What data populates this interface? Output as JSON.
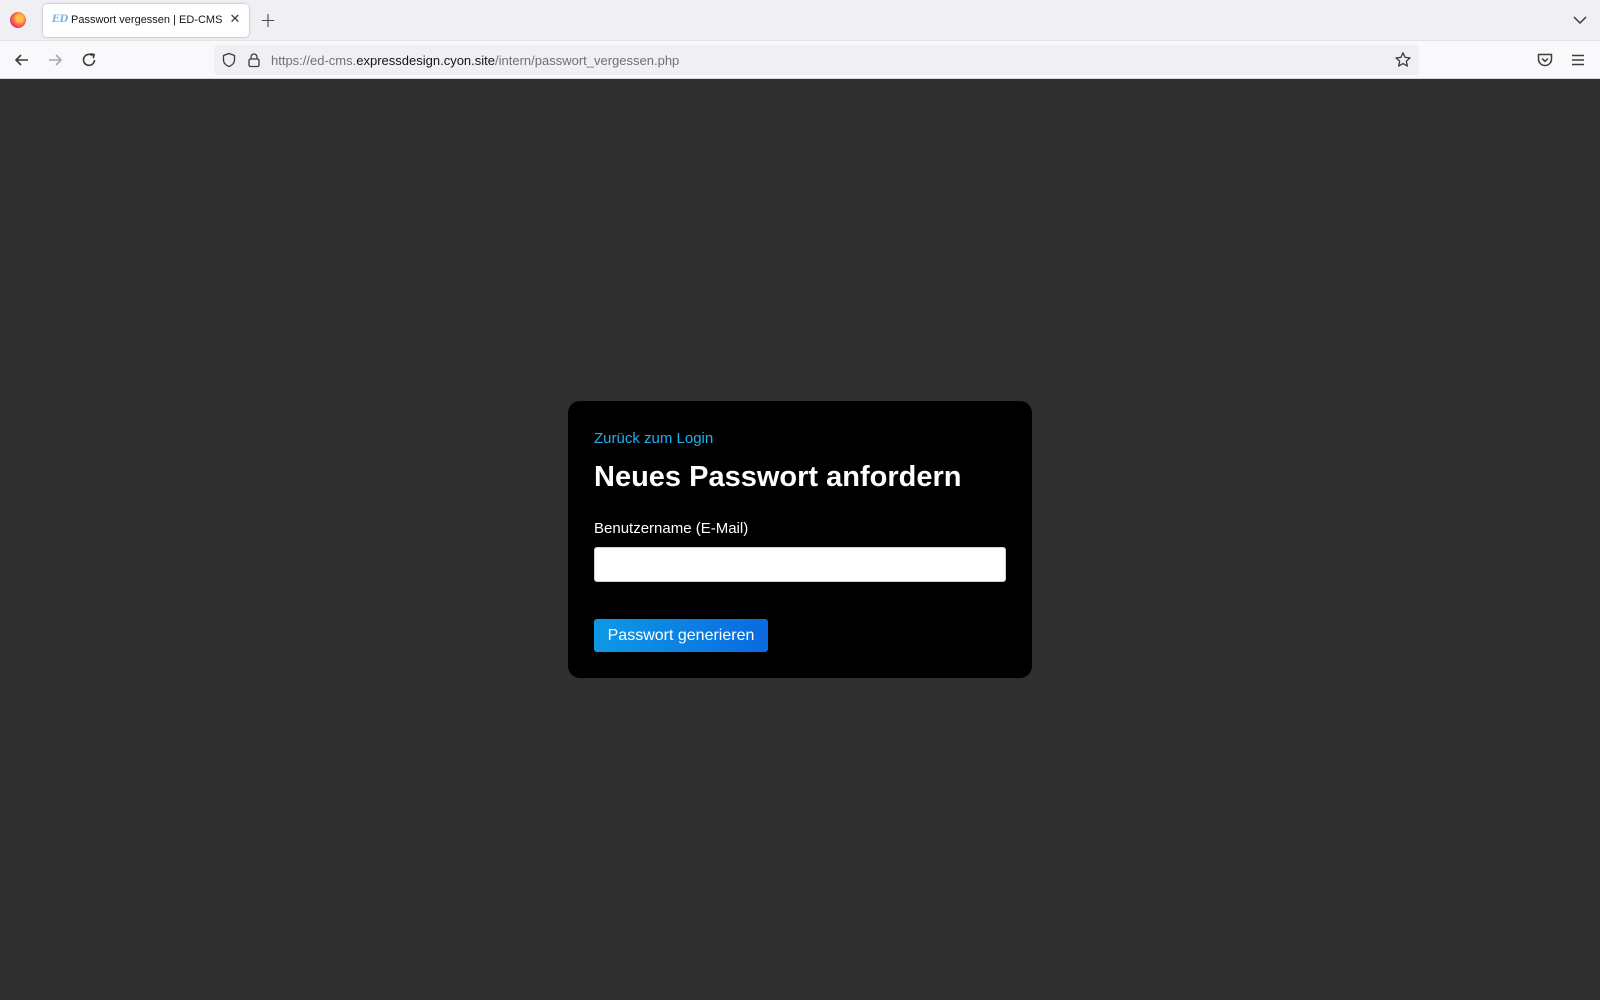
{
  "browser": {
    "tab": {
      "favicon_text": "ED",
      "title": "Passwort vergessen | ED-CMS",
      "close_glyph": "✕"
    },
    "new_tab_glyph": "+",
    "url": {
      "prefix": "https://ed-cms.",
      "domain": "expressdesign.cyon.site",
      "path": "/intern/passwort_vergessen.php"
    },
    "icons": [
      "firefox-logo-icon",
      "back-arrow-icon",
      "forward-arrow-icon",
      "reload-icon",
      "shield-icon",
      "lock-icon",
      "star-icon",
      "pocket-icon",
      "menu-icon",
      "tab-list-chevron-icon"
    ]
  },
  "page": {
    "back_link": "Zurück zum Login",
    "heading": "Neues Passwort anfordern",
    "email_label": "Benutzername (E-Mail)",
    "email_value": "",
    "submit_label": "Passwort generieren"
  },
  "colors": {
    "page_background": "#2f2f2f",
    "card_background": "#000000",
    "link": "#1ab2f0",
    "button_gradient_start": "#0d99e6",
    "button_gradient_end": "#0a6ae0"
  }
}
